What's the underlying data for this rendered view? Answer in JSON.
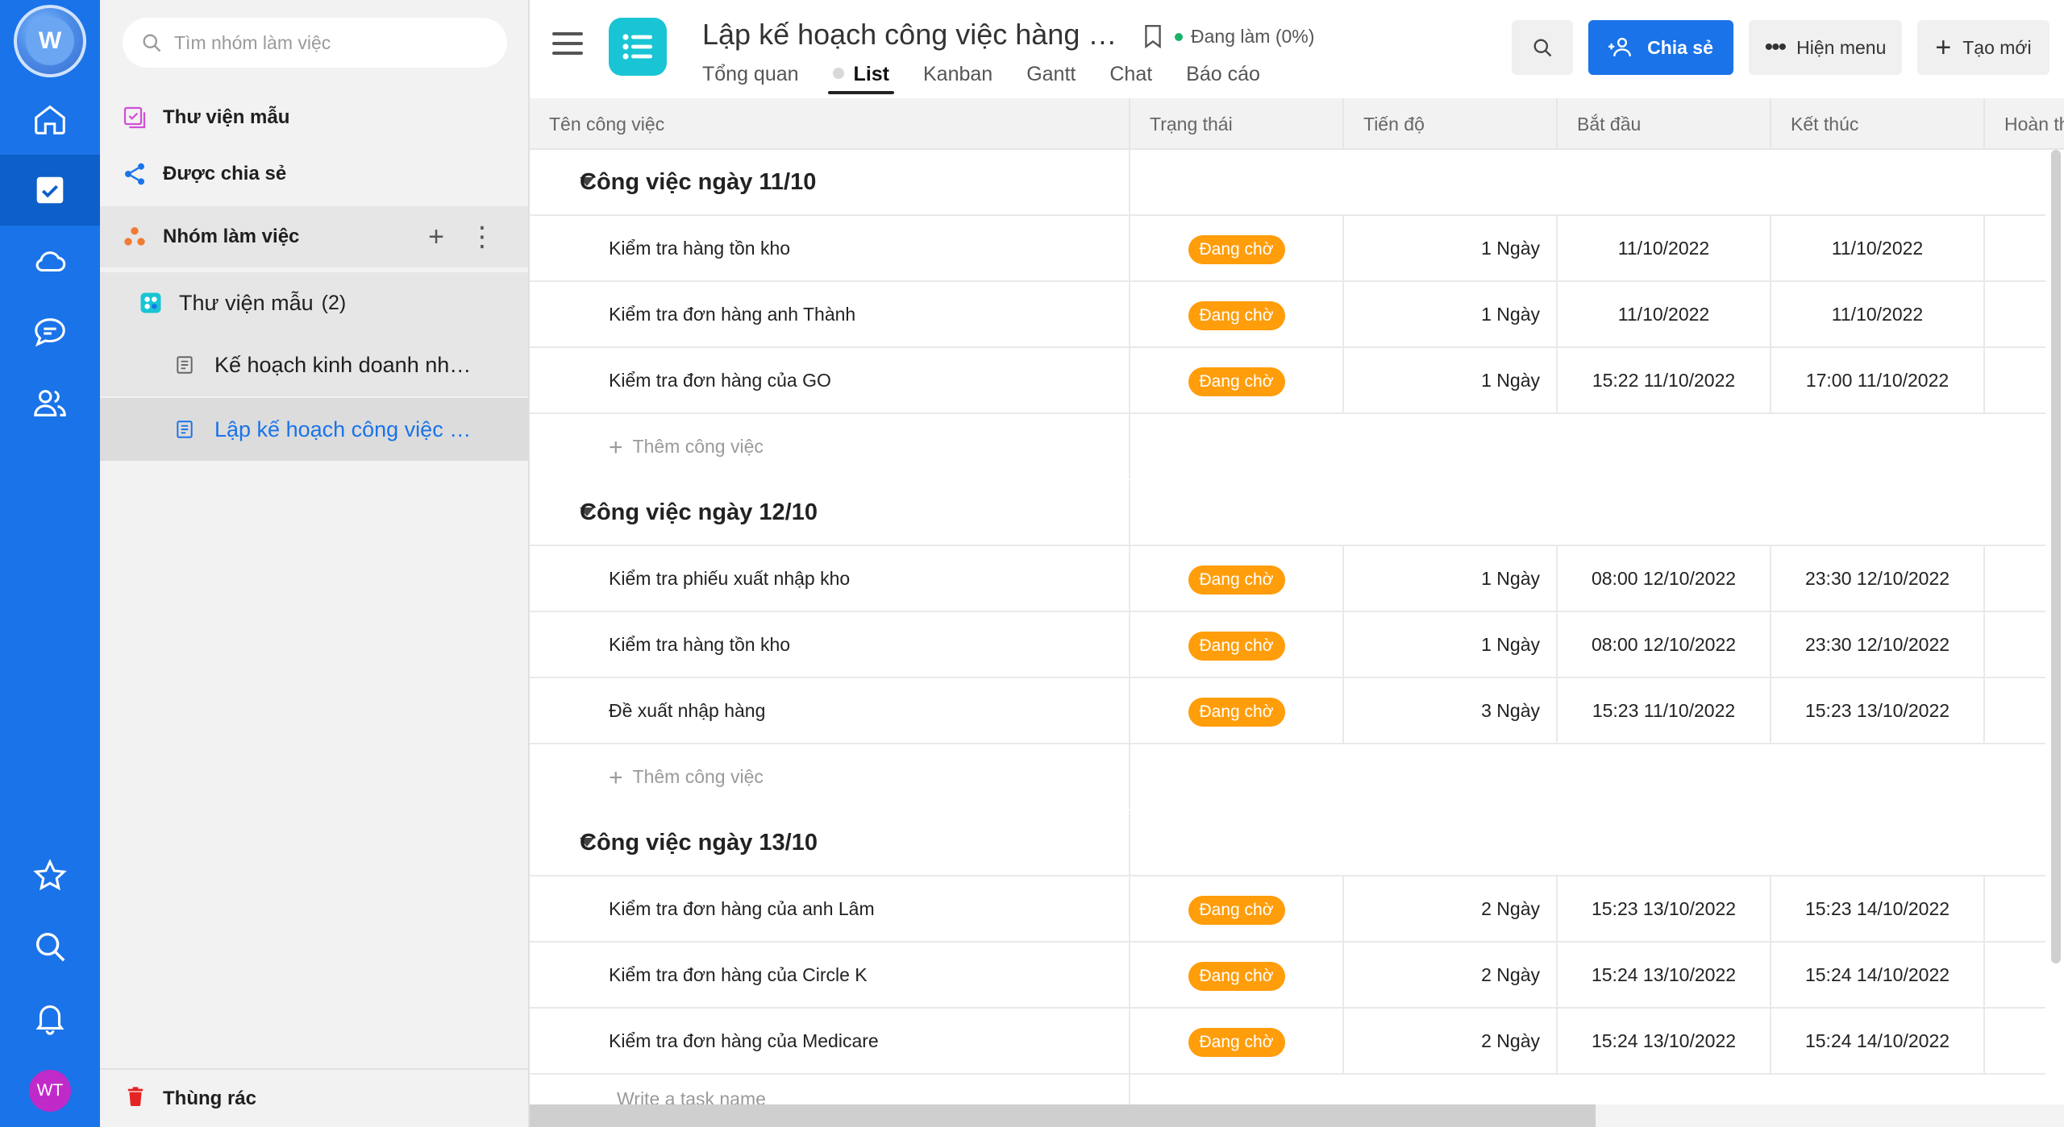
{
  "rail": {
    "logo_letter": "W",
    "user_initials": "WT",
    "icons": [
      "home-icon",
      "tasks-icon",
      "cloud-icon",
      "chat-icon",
      "users-icon",
      "star-icon",
      "search-icon",
      "bell-icon"
    ]
  },
  "sidebar": {
    "search_placeholder": "Tìm nhóm làm việc",
    "template_library": "Thư viện mẫu",
    "shared": "Được chia sẻ",
    "groups": "Nhóm làm việc",
    "group_add": "+",
    "group_more": "⋮",
    "sub_group": "Thư viện mẫu",
    "sub_group_count": "(2)",
    "docs": [
      {
        "label": "Kế hoạch kinh doanh nh…",
        "active": false
      },
      {
        "label": "Lập kế hoạch công việc …",
        "active": true
      }
    ],
    "trash": "Thùng rác"
  },
  "header": {
    "title": "Lập kế hoạch công việc hàng n…",
    "status": "Đang làm (0%)",
    "tabs": [
      "Tổng quan",
      "List",
      "Kanban",
      "Gantt",
      "Chat",
      "Báo cáo"
    ],
    "active_tab": "List",
    "share_label": "Chia sẻ",
    "menu_label": "Hiện menu",
    "new_label": "Tạo mới"
  },
  "table": {
    "columns": [
      "Tên công việc",
      "Trạng thái",
      "Tiến độ",
      "Bắt đầu",
      "Kết thúc",
      "Hoàn th"
    ],
    "add_task_label": "Thêm công việc",
    "write_task_placeholder": "Write a task name",
    "groups": [
      {
        "title": "Công việc ngày 11/10",
        "tasks": [
          {
            "name": "Kiểm tra hàng tồn kho",
            "status": "Đang chờ",
            "duration": "1 Ngày",
            "start": "11/10/2022",
            "end": "11/10/2022"
          },
          {
            "name": "Kiểm tra đơn hàng anh Thành",
            "status": "Đang chờ",
            "duration": "1 Ngày",
            "start": "11/10/2022",
            "end": "11/10/2022"
          },
          {
            "name": "Kiểm tra đơn hàng của GO",
            "status": "Đang chờ",
            "duration": "1 Ngày",
            "start": "15:22 11/10/2022",
            "end": "17:00 11/10/2022"
          }
        ]
      },
      {
        "title": "Công việc ngày 12/10",
        "tasks": [
          {
            "name": "Kiểm tra phiếu xuất nhập kho",
            "status": "Đang chờ",
            "duration": "1 Ngày",
            "start": "08:00 12/10/2022",
            "end": "23:30 12/10/2022"
          },
          {
            "name": "Kiểm tra hàng tồn kho",
            "status": "Đang chờ",
            "duration": "1 Ngày",
            "start": "08:00 12/10/2022",
            "end": "23:30 12/10/2022"
          },
          {
            "name": "Đề xuất nhập hàng",
            "status": "Đang chờ",
            "duration": "3 Ngày",
            "start": "15:23 11/10/2022",
            "end": "15:23 13/10/2022"
          }
        ]
      },
      {
        "title": "Công việc ngày 13/10",
        "tasks": [
          {
            "name": "Kiểm tra đơn hàng của anh Lâm",
            "status": "Đang chờ",
            "duration": "2 Ngày",
            "start": "15:23 13/10/2022",
            "end": "15:23 14/10/2022"
          },
          {
            "name": "Kiểm tra đơn hàng của Circle K",
            "status": "Đang chờ",
            "duration": "2 Ngày",
            "start": "15:24 13/10/2022",
            "end": "15:24 14/10/2022"
          },
          {
            "name": "Kiểm tra đơn hàng của Medicare",
            "status": "Đang chờ",
            "duration": "2 Ngày",
            "start": "15:24 13/10/2022",
            "end": "15:24 14/10/2022"
          }
        ]
      }
    ]
  },
  "colors": {
    "primary": "#1a73e8",
    "status_pending": "#ff9d0a",
    "app_icon": "#19c5d4",
    "avatar": "#c02ac9"
  }
}
